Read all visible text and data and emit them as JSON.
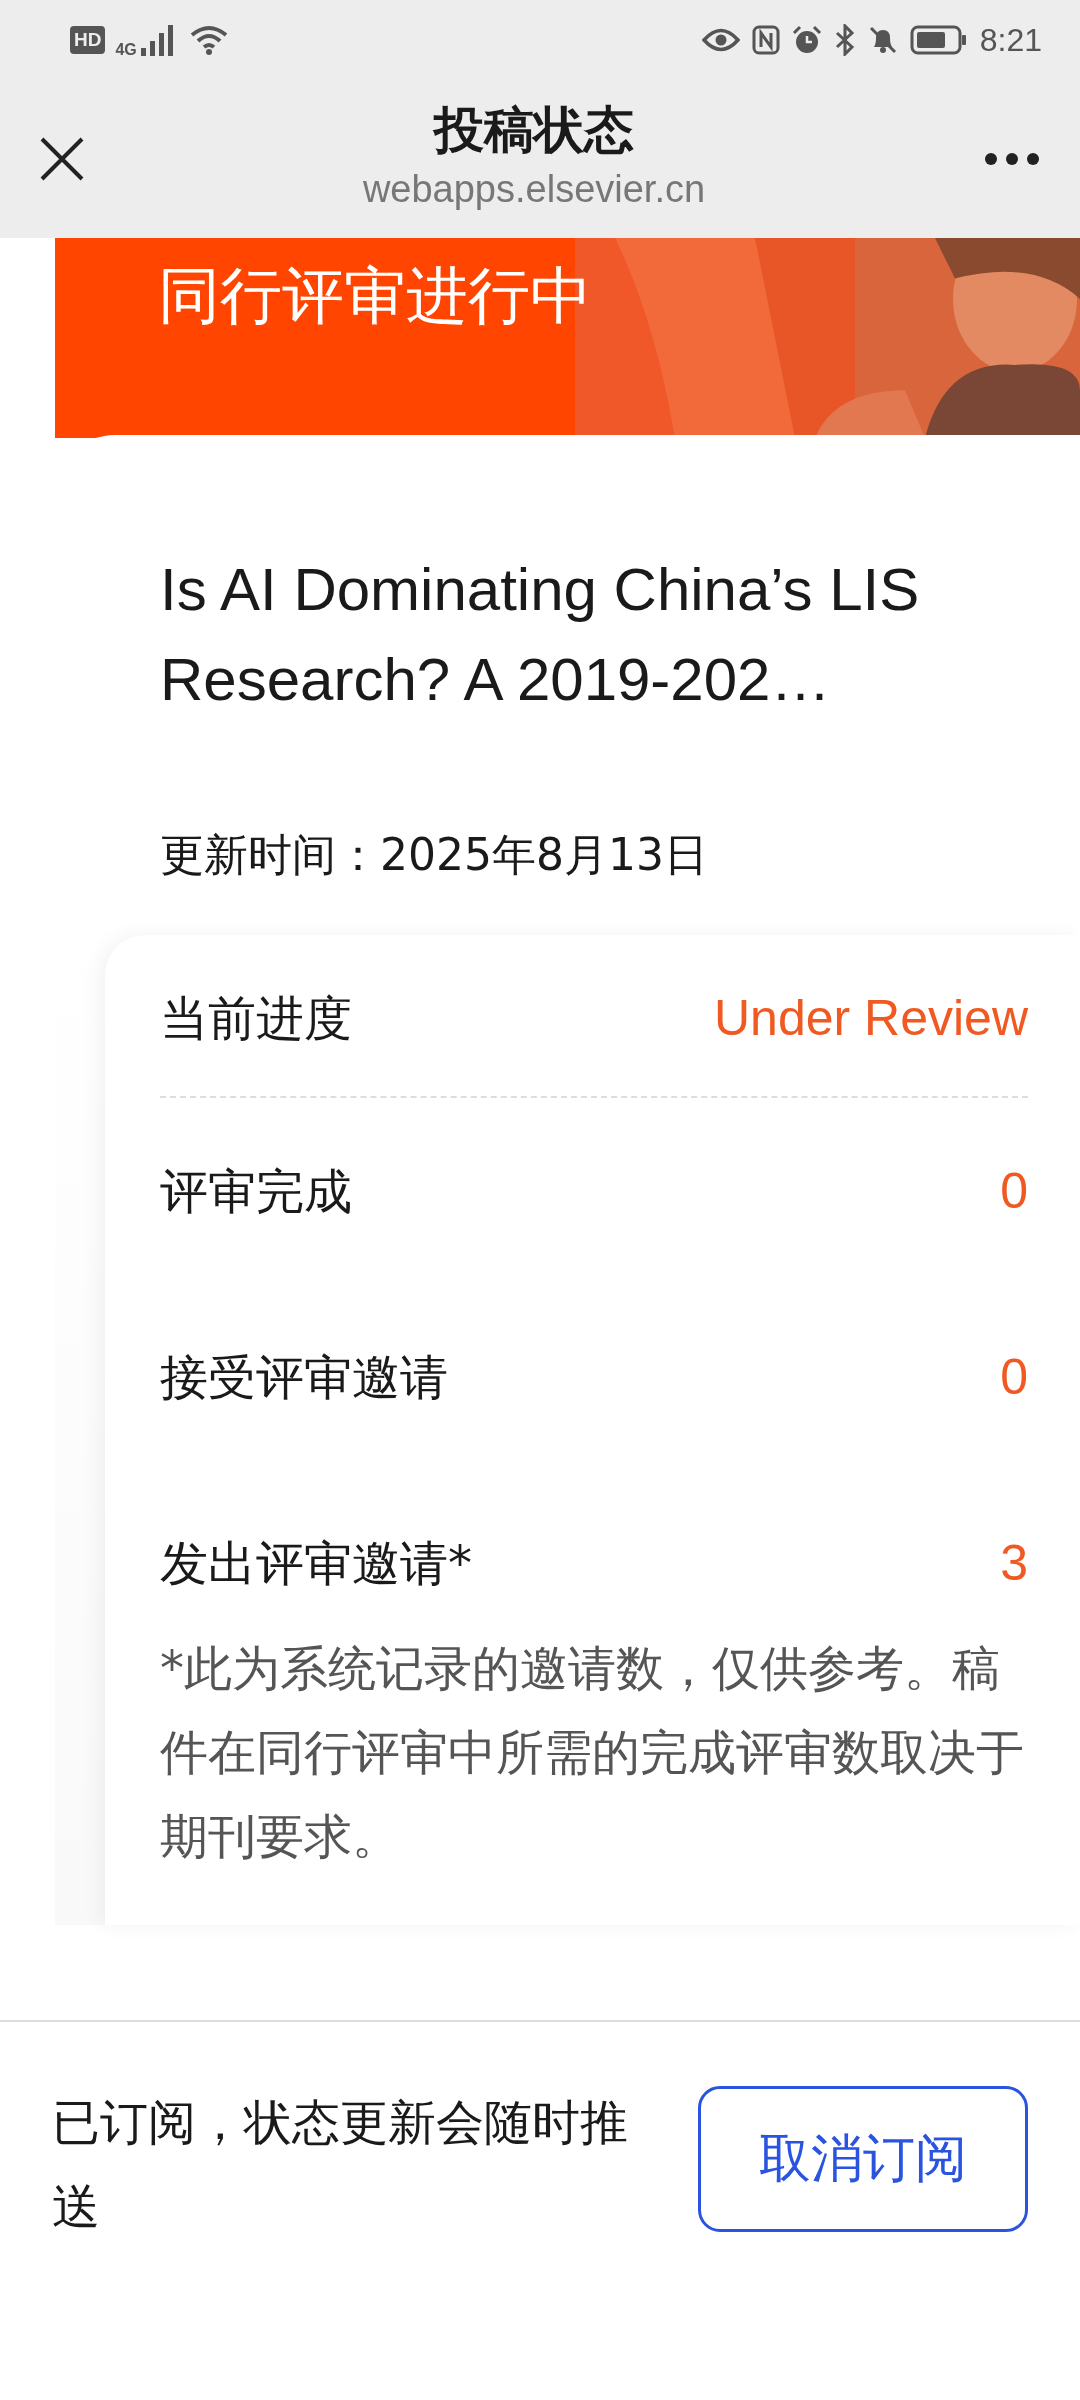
{
  "status_bar": {
    "hd_badge": "HD",
    "network": "4G",
    "time": "8:21"
  },
  "header": {
    "title": "投稿状态",
    "subtitle": "webapps.elsevier.cn"
  },
  "banner": {
    "title": "同行评审进行中",
    "kind": "picture"
  },
  "manuscript": {
    "title": "Is AI Dominating China’s LIS Research? A 2019-202…",
    "updated": "更新时间：2025年8月13日"
  },
  "progress": {
    "label": "当前进度",
    "value": "Under Review"
  },
  "stats": [
    {
      "label": "评审完成",
      "value": "0"
    },
    {
      "label": "接受评审邀请",
      "value": "0"
    },
    {
      "label": "发出评审邀请*",
      "value": "3"
    }
  ],
  "note": "*此为系统记录的邀请数，仅供参考。稿件在同行评审中所需的完成评审数取决于期刊要求。",
  "footer": {
    "message": "已订阅，状态更新会随时推送",
    "button": "取消订阅"
  }
}
